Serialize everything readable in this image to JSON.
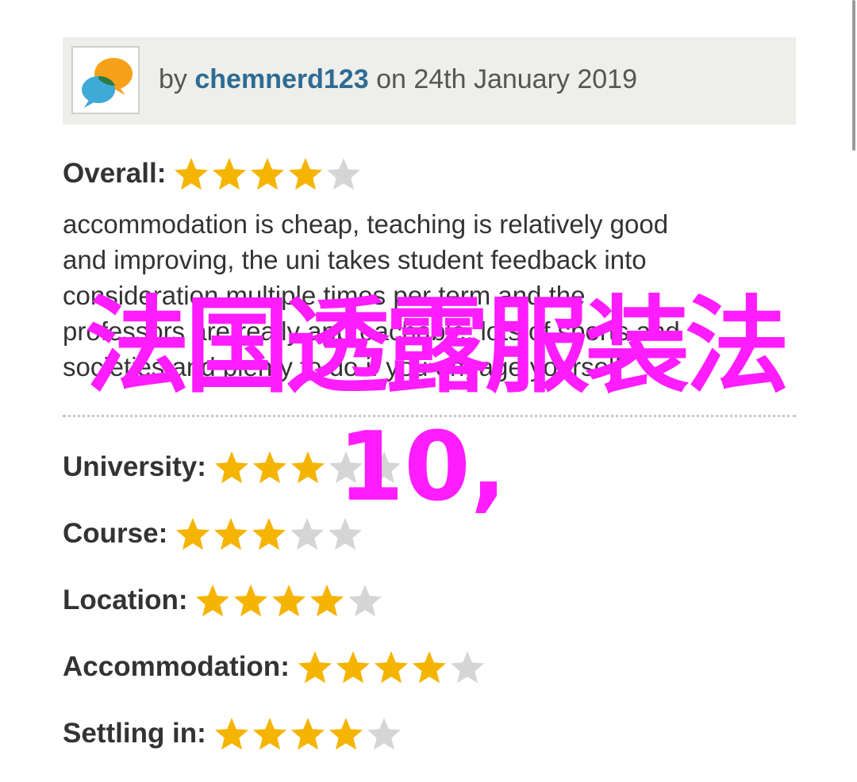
{
  "review": {
    "by_label": "by",
    "author": "chemnerd123",
    "date_text": "on 24th January 2019",
    "avatar_icon": "chat-bubbles-icon",
    "overall_label": "Overall:",
    "overall_stars": 4,
    "comment_lines": [
      "accommodation is cheap, teaching is relatively good",
      "and improving, the uni takes student feedback into",
      "consideration multiple times per term and the",
      "professors are really approachable, lots of sports and",
      "societies and plenty to do if you engage yourself"
    ],
    "ratings": [
      {
        "label": "University:",
        "stars": 3
      },
      {
        "label": "Course:",
        "stars": 3
      },
      {
        "label": "Location:",
        "stars": 4
      },
      {
        "label": "Accommodation:",
        "stars": 4
      },
      {
        "label": "Settling in:",
        "stars": 4
      }
    ],
    "max_stars": 5
  },
  "overlay": {
    "line1": "法国透露服装法",
    "line2": "10,"
  },
  "colors": {
    "star_filled": "#f5b400",
    "star_empty": "#d5d5d5",
    "author_link": "#2e6b94",
    "header_bg": "#eeeeea",
    "overlay": "#ff1cff"
  }
}
